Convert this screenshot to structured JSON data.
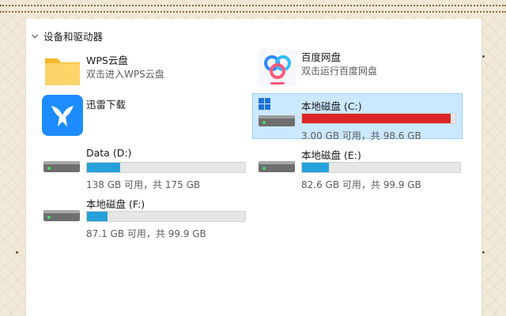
{
  "section": {
    "title": "设备和驱动器"
  },
  "apps": [
    {
      "name": "WPS云盘",
      "description": "双击进入WPS云盘",
      "icon": "folder-icon"
    },
    {
      "name": "百度网盘",
      "description": "双击运行百度网盘",
      "icon": "baidu-netdisk-icon"
    },
    {
      "name": "迅雷下载",
      "icon": "xunlei-bird-icon"
    }
  ],
  "drives": [
    {
      "name": "本地磁盘 (C:)",
      "usage": "3.00 GB 可用，共 98.6 GB",
      "used_fraction": 0.97,
      "selected": true,
      "icon": "windows-drive-icon"
    },
    {
      "name": "Data (D:)",
      "usage": "138 GB 可用，共 175 GB",
      "used_fraction": 0.21,
      "icon": "hard-drive-icon"
    },
    {
      "name": "本地磁盘 (E:)",
      "usage": "82.6 GB 可用，共 99.9 GB",
      "used_fraction": 0.17,
      "icon": "hard-drive-icon"
    },
    {
      "name": "本地磁盘 (F:)",
      "usage": "87.1 GB 可用，共 99.9 GB",
      "used_fraction": 0.13,
      "icon": "hard-drive-icon"
    }
  ],
  "colors": {
    "bar_normal": "#26a0da",
    "bar_full": "#da2626",
    "selection": "#cce8ff"
  }
}
